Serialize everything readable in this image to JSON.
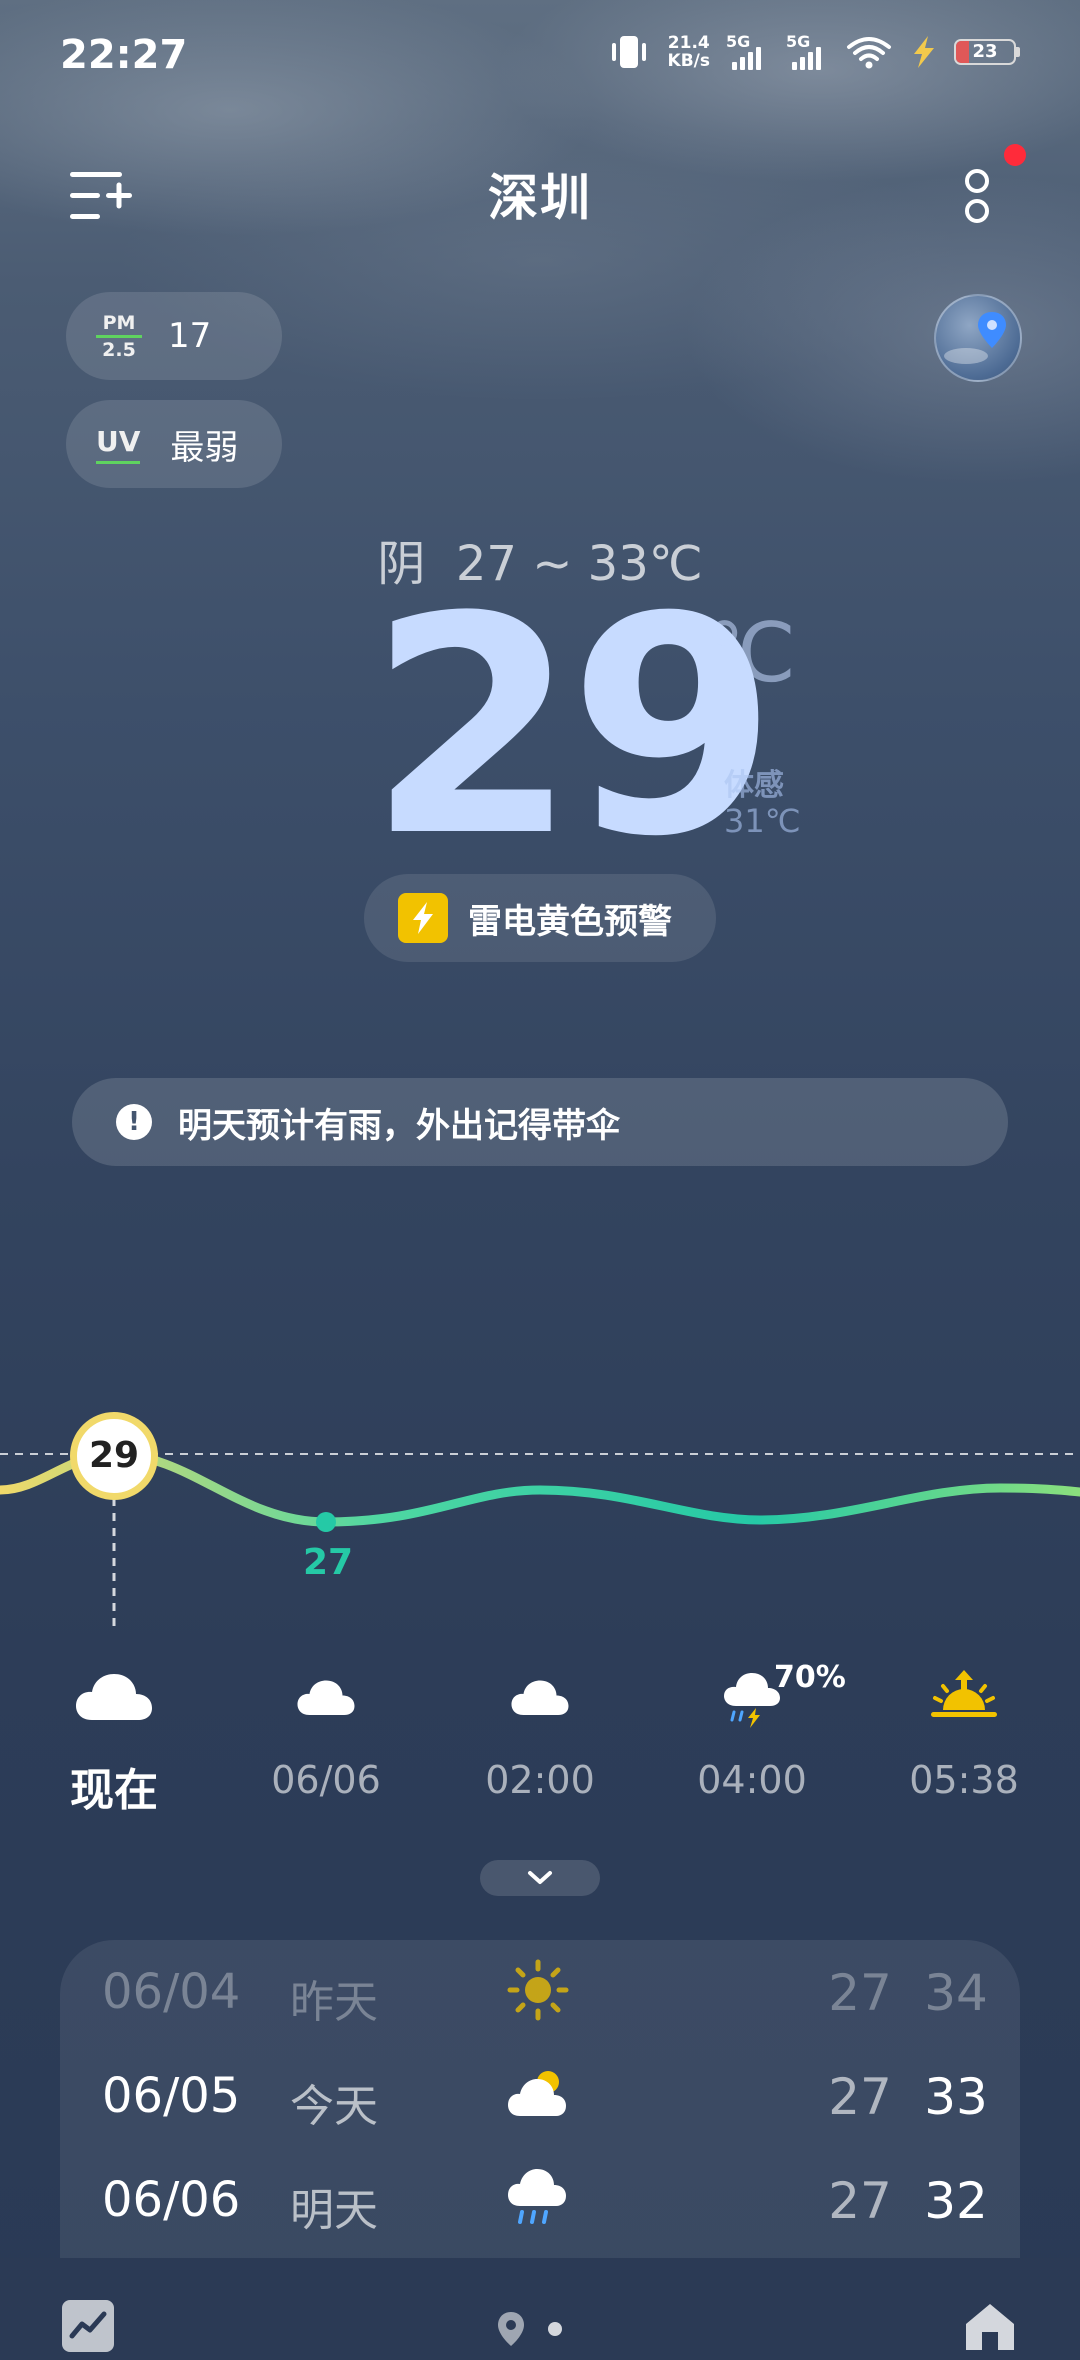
{
  "status_bar": {
    "time": "22:27",
    "net_speed_value": "21.4",
    "net_speed_unit": "KB/s",
    "sim1": "5G",
    "sim2": "5G",
    "battery": "23"
  },
  "header": {
    "city": "深圳"
  },
  "air": {
    "pm_label_top": "PM",
    "pm_label_bottom": "2.5",
    "pm_value": "17",
    "uv_label": "UV",
    "uv_value": "最弱"
  },
  "current": {
    "condition": "阴",
    "range": "27 ~ 33℃",
    "temp": "29",
    "unit": "℃",
    "feels_label": "体感",
    "feels_value": "31℃",
    "alert": "雷电黄色预警"
  },
  "tip": {
    "text": "明天预计有雨，外出记得带伞"
  },
  "hourly": {
    "now_temp": "29",
    "low_temp": "27",
    "items": [
      {
        "label": "现在",
        "icon": "cloud-icon"
      },
      {
        "label": "06/06",
        "icon": "cloud-icon"
      },
      {
        "label": "02:00",
        "icon": "cloud-icon"
      },
      {
        "label": "04:00",
        "icon": "thunder-rain-icon",
        "precip": "70%"
      },
      {
        "label": "05:38",
        "icon": "sunrise-icon"
      }
    ]
  },
  "daily": [
    {
      "date": "06/04",
      "day": "昨天",
      "icon": "sun-icon",
      "low": "27",
      "high": "34"
    },
    {
      "date": "06/05",
      "day": "今天",
      "icon": "partly-cloudy-icon",
      "low": "27",
      "high": "33"
    },
    {
      "date": "06/06",
      "day": "明天",
      "icon": "rain-icon",
      "low": "27",
      "high": "32"
    }
  ],
  "colors": {
    "temp_big": "#c7dbff",
    "curve_start": "#f1d96a",
    "curve_end": "#25c9a6",
    "alert_yellow": "#f2c200",
    "notify_red": "#ff2b3a"
  }
}
